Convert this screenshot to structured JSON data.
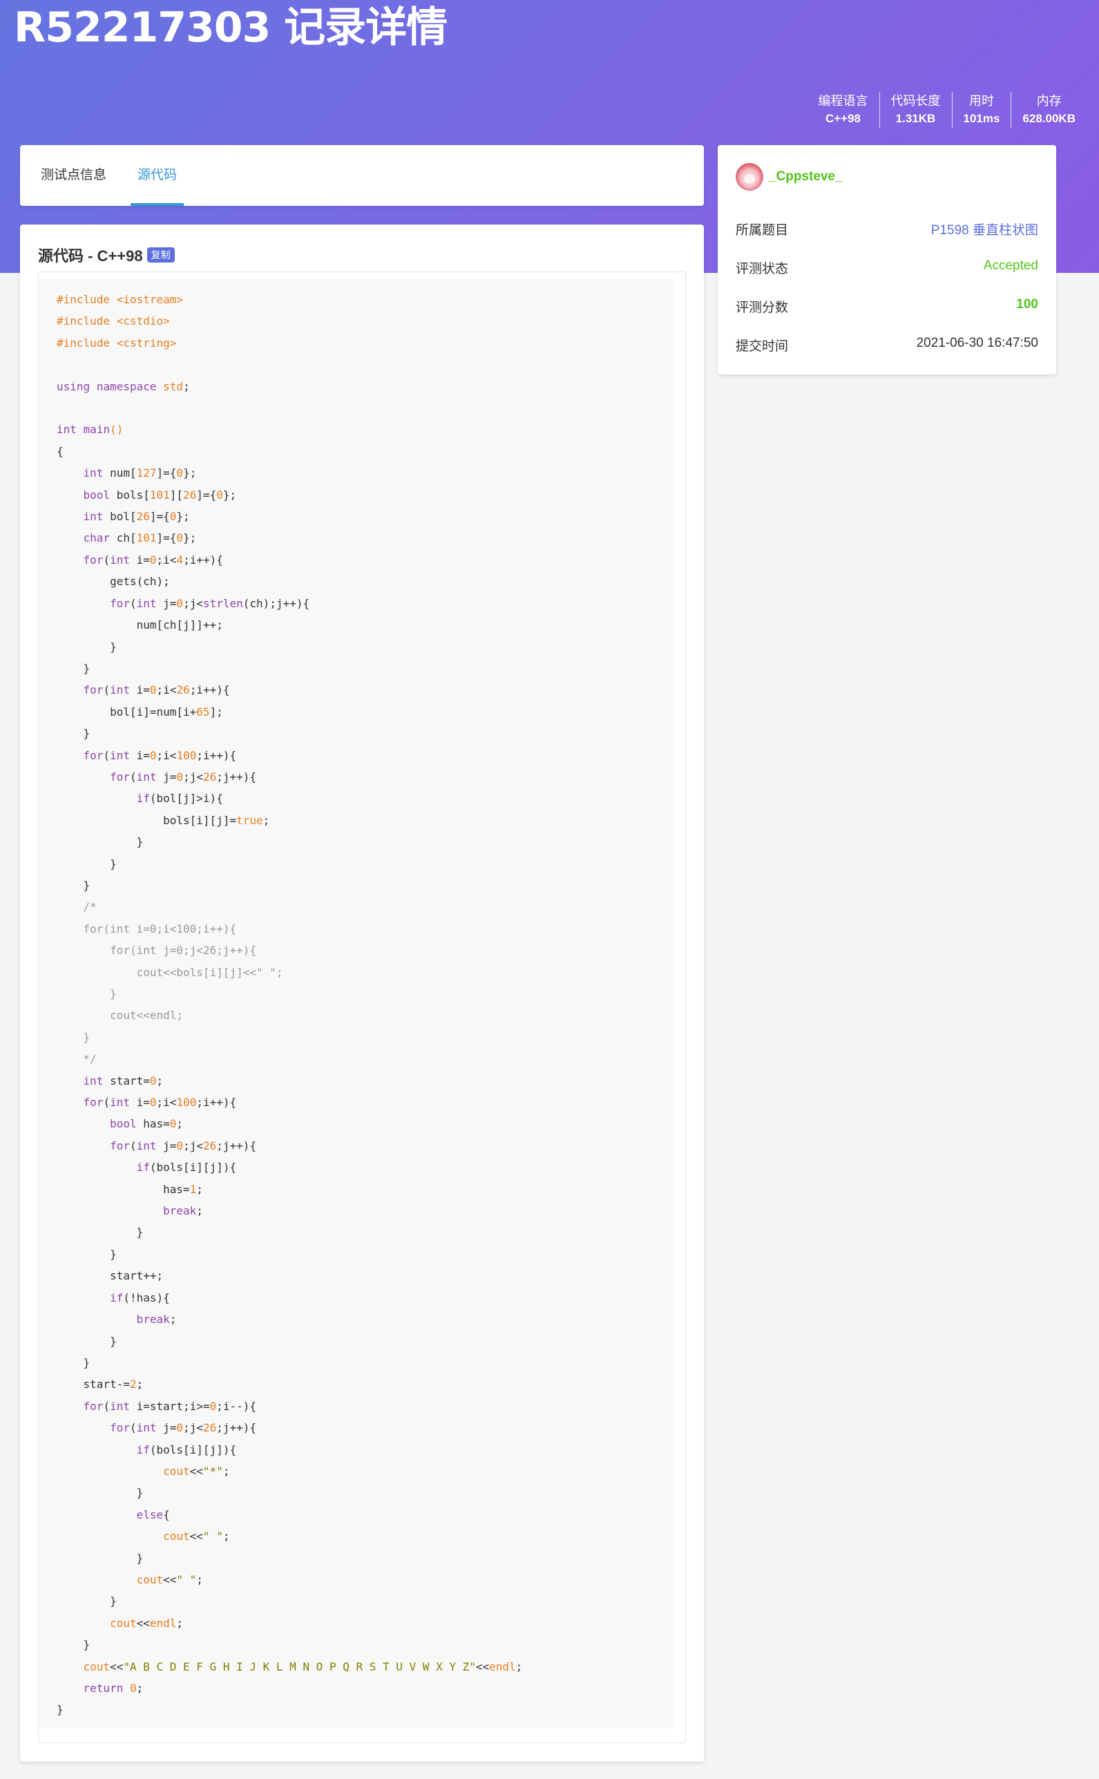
{
  "header": {
    "title": "R52217303 记录详情",
    "stats": [
      {
        "label": "编程语言",
        "value": "C++98"
      },
      {
        "label": "代码长度",
        "value": "1.31KB"
      },
      {
        "label": "用时",
        "value": "101ms"
      },
      {
        "label": "内存",
        "value": "628.00KB"
      }
    ]
  },
  "tabs": [
    {
      "label": "测试点信息"
    },
    {
      "label": "源代码"
    }
  ],
  "code_section": {
    "title": "源代码 - C++98",
    "copy_label": "复制"
  },
  "sidebar": {
    "username": "_Cppsteve_",
    "rows": [
      {
        "label": "所属题目",
        "value": "P1598 垂直柱状图"
      },
      {
        "label": "评测状态",
        "value": "Accepted"
      },
      {
        "label": "评测分数",
        "value": "100"
      },
      {
        "label": "提交时间",
        "value": "2021-06-30 16:47:50"
      }
    ]
  },
  "colors": {
    "header_gradient_start": "#6574e0",
    "header_gradient_end": "#8a5de6",
    "link": "#5b6fde",
    "accepted": "#52c41a",
    "active_tab": "#3498db"
  }
}
